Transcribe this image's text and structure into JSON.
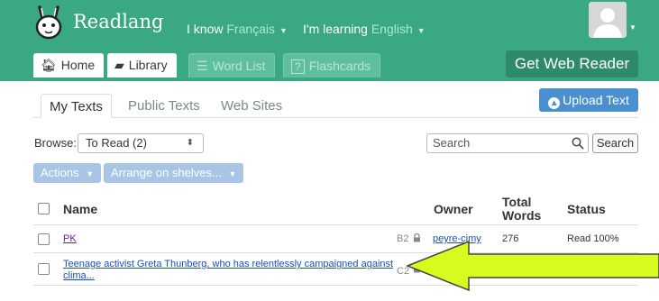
{
  "header": {
    "brand": "Readlang",
    "know_prefix": "I know ",
    "know_lang": "Français",
    "learning_prefix": "I'm learning ",
    "learning_lang": "English",
    "get_web_reader": "Get Web Reader"
  },
  "tabs": [
    {
      "label": "Home",
      "icon": "home-icon"
    },
    {
      "label": "Library",
      "icon": "book-icon"
    },
    {
      "label": "Word List",
      "icon": "list-icon"
    },
    {
      "label": "Flashcards",
      "icon": "question-icon"
    }
  ],
  "subtabs": [
    "My Texts",
    "Public Texts",
    "Web Sites"
  ],
  "upload_label": "Upload Text",
  "browse": {
    "label": "Browse:",
    "value": "To Read (2)"
  },
  "search": {
    "placeholder": "Search",
    "button": "Search"
  },
  "actions_label": "Actions",
  "arrange_label": "Arrange on shelves...",
  "table": {
    "headers": {
      "name": "Name",
      "owner": "Owner",
      "total_words_1": "Total",
      "total_words_2": "Words",
      "status": "Status"
    },
    "rows": [
      {
        "name": "PK",
        "level": "B2",
        "owner": "peyre-cimy",
        "words": "276",
        "status": "Read 100%"
      },
      {
        "name_1": "Teenage activist Greta Thunberg, who has relentlessly campaigned against",
        "name_2": "clima...",
        "level": "C2"
      }
    ]
  },
  "colors": {
    "header_green": "#3aa981",
    "upload_blue": "#4a90cf",
    "arrow_fill": "#d6fb1f"
  }
}
